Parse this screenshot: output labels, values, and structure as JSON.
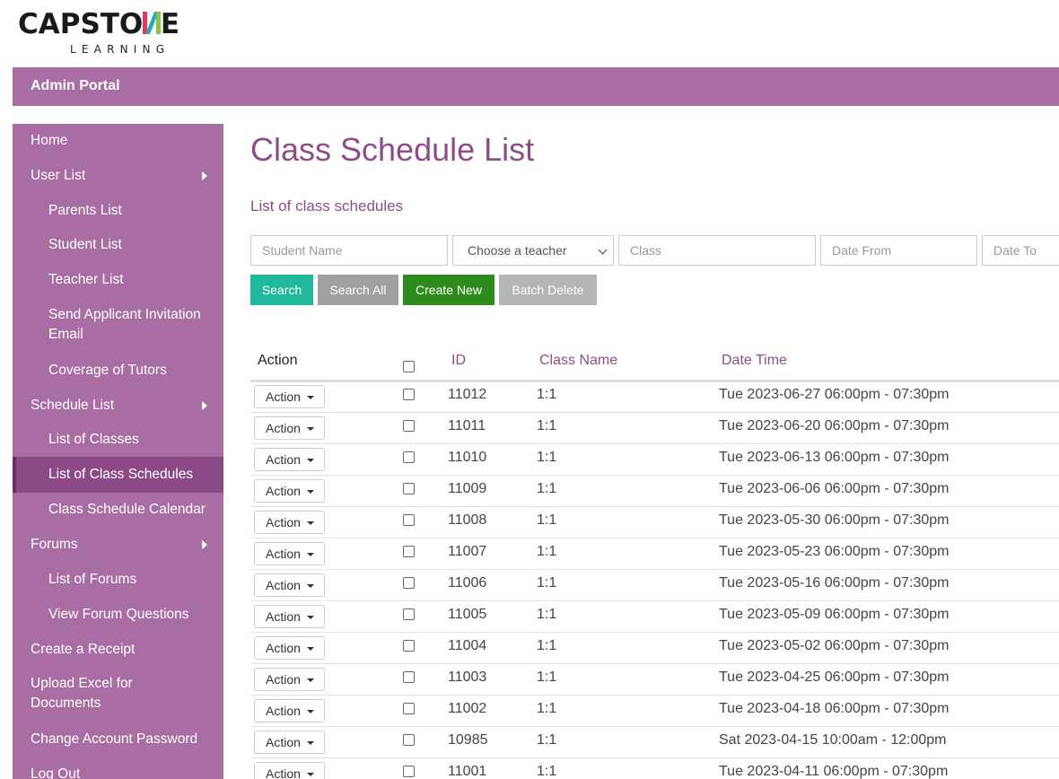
{
  "logo": {
    "main": "CAPSTO",
    "end": "E",
    "sub": "LEARNING",
    "colors": [
      "#e23b5a",
      "#2aa7c7",
      "#8bc34a"
    ]
  },
  "portal": {
    "title": "Admin Portal"
  },
  "sidebar": {
    "items": [
      {
        "label": "Home",
        "level": 1
      },
      {
        "label": "User List",
        "level": 1,
        "expandable": true
      },
      {
        "label": "Parents List",
        "level": 2
      },
      {
        "label": "Student List",
        "level": 2
      },
      {
        "label": "Teacher List",
        "level": 2
      },
      {
        "label": "Send Applicant Invitation Email",
        "level": 2
      },
      {
        "label": "Coverage of Tutors",
        "level": 2
      },
      {
        "label": "Schedule List",
        "level": 1,
        "expandable": true
      },
      {
        "label": "List of Classes",
        "level": 2
      },
      {
        "label": "List of Class Schedules",
        "level": 2,
        "active": true
      },
      {
        "label": "Class Schedule Calendar",
        "level": 2
      },
      {
        "label": "Forums",
        "level": 1,
        "expandable": true
      },
      {
        "label": "List of Forums",
        "level": 2
      },
      {
        "label": "View Forum Questions",
        "level": 2
      },
      {
        "label": "Create a Receipt",
        "level": 1
      },
      {
        "label": "Upload Excel for Documents",
        "level": 1
      },
      {
        "label": "Change Account Password",
        "level": 1
      },
      {
        "label": "Log Out",
        "level": 1
      }
    ]
  },
  "main": {
    "title": "Class Schedule List",
    "subtitle": "List of class schedules",
    "filters": {
      "student_placeholder": "Student Name",
      "teacher_selected": "Choose a teacher",
      "class_placeholder": "Class",
      "date_from_placeholder": "Date From",
      "date_to_placeholder": "Date To"
    },
    "buttons": {
      "search": "Search",
      "search_all": "Search All",
      "create_new": "Create New",
      "batch_delete": "Batch Delete"
    },
    "table": {
      "headers": {
        "action": "Action",
        "id": "ID",
        "class_name": "Class Name",
        "date_time": "Date Time"
      },
      "action_label": "Action",
      "rows": [
        {
          "id": "11012",
          "class_name": "1:1",
          "date_time": "Tue 2023-06-27 06:00pm - 07:30pm"
        },
        {
          "id": "11011",
          "class_name": "1:1",
          "date_time": "Tue 2023-06-20 06:00pm - 07:30pm"
        },
        {
          "id": "11010",
          "class_name": "1:1",
          "date_time": "Tue 2023-06-13 06:00pm - 07:30pm"
        },
        {
          "id": "11009",
          "class_name": "1:1",
          "date_time": "Tue 2023-06-06 06:00pm - 07:30pm"
        },
        {
          "id": "11008",
          "class_name": "1:1",
          "date_time": "Tue 2023-05-30 06:00pm - 07:30pm"
        },
        {
          "id": "11007",
          "class_name": "1:1",
          "date_time": "Tue 2023-05-23 06:00pm - 07:30pm"
        },
        {
          "id": "11006",
          "class_name": "1:1",
          "date_time": "Tue 2023-05-16 06:00pm - 07:30pm"
        },
        {
          "id": "11005",
          "class_name": "1:1",
          "date_time": "Tue 2023-05-09 06:00pm - 07:30pm"
        },
        {
          "id": "11004",
          "class_name": "1:1",
          "date_time": "Tue 2023-05-02 06:00pm - 07:30pm"
        },
        {
          "id": "11003",
          "class_name": "1:1",
          "date_time": "Tue 2023-04-25 06:00pm - 07:30pm"
        },
        {
          "id": "11002",
          "class_name": "1:1",
          "date_time": "Tue 2023-04-18 06:00pm - 07:30pm"
        },
        {
          "id": "10985",
          "class_name": "1:1",
          "date_time": "Sat 2023-04-15 10:00am - 12:00pm"
        },
        {
          "id": "11001",
          "class_name": "1:1",
          "date_time": "Tue 2023-04-11 06:00pm - 07:30pm"
        }
      ]
    }
  },
  "colors": {
    "brand": "#a86da2",
    "active": "#8b4a85",
    "title": "#8e4d88",
    "search": "#1fb89a",
    "create": "#2e8b1e",
    "gray": "#a0a0a0"
  }
}
